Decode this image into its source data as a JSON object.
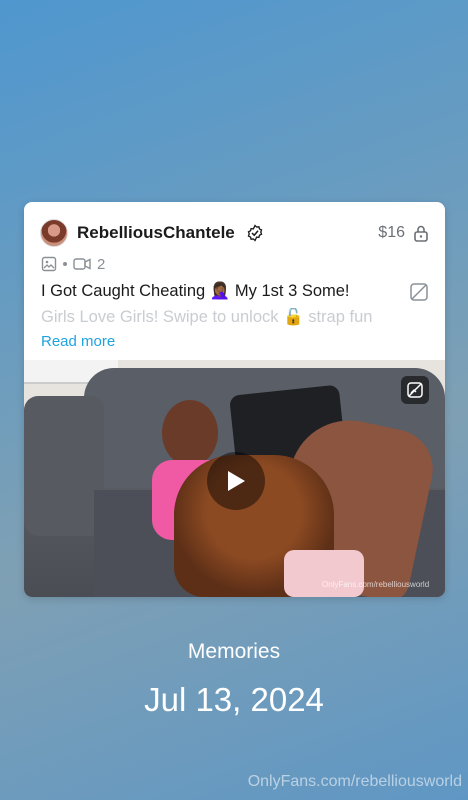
{
  "post": {
    "username": "RebelliousChantele",
    "price": "$16",
    "video_count": "2",
    "caption_line1": "I Got Caught Cheating 🤦🏾‍♀️ My 1st 3 Some!",
    "caption_line2": "Girls Love Girls! Swipe to unlock 🔓 strap fun",
    "read_more": "Read more",
    "watermark": "OnlyFans.com/rebelliousworld"
  },
  "memories": {
    "label": "Memories",
    "date": "Jul 13, 2024"
  },
  "footer": {
    "watermark": "OnlyFans.com/rebelliousworld"
  },
  "colors": {
    "accent": "#1fa3e0",
    "muted": "#8a9095"
  },
  "icons": [
    "verified-icon",
    "lock-icon",
    "image-icon",
    "video-icon",
    "hide-icon",
    "play-icon"
  ]
}
